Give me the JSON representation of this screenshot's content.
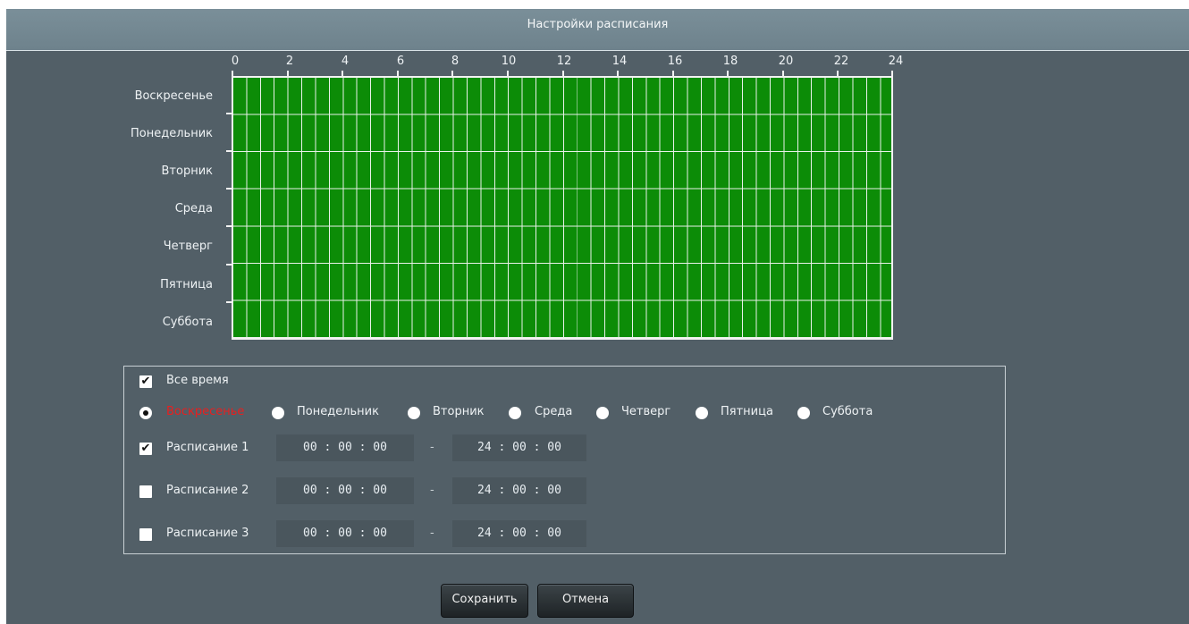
{
  "header": {
    "title": "Настройки расписания"
  },
  "grid": {
    "days": [
      "Воскресенье",
      "Понедельник",
      "Вторник",
      "Среда",
      "Четверг",
      "Пятница",
      "Суббота"
    ],
    "hours": [
      "0",
      "2",
      "4",
      "6",
      "8",
      "10",
      "12",
      "14",
      "16",
      "18",
      "20",
      "22",
      "24"
    ],
    "fill_color": "#0c8c07",
    "all_selected": true
  },
  "options": {
    "all_time_label": "Все время",
    "all_time_checked": true,
    "day_radios": [
      {
        "label": "Воскресенье",
        "selected": true
      },
      {
        "label": "Понедельник",
        "selected": false
      },
      {
        "label": "Вторник",
        "selected": false
      },
      {
        "label": "Среда",
        "selected": false
      },
      {
        "label": "Четверг",
        "selected": false
      },
      {
        "label": "Пятница",
        "selected": false
      },
      {
        "label": "Суббота",
        "selected": false
      }
    ],
    "selected_day_color": "#e81f1f",
    "schedules": [
      {
        "label": "Расписание 1",
        "checked": true,
        "start": "00 : 00 : 00",
        "end": "24 : 00 : 00"
      },
      {
        "label": "Расписание 2",
        "checked": false,
        "start": "00 : 00 : 00",
        "end": "24 : 00 : 00"
      },
      {
        "label": "Расписание 3",
        "checked": false,
        "start": "00 : 00 : 00",
        "end": "24 : 00 : 00"
      }
    ],
    "separator": "-"
  },
  "buttons": {
    "save": "Сохранить",
    "cancel": "Отмена"
  }
}
